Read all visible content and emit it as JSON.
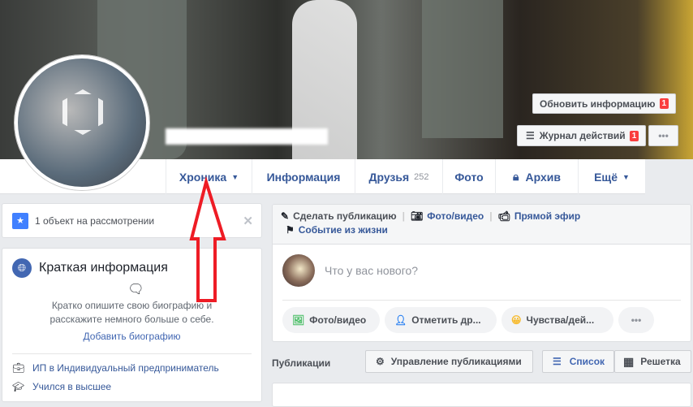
{
  "cover": {
    "update_info": "Обновить информацию",
    "update_badge": "1",
    "activity_log": "Журнал действий",
    "activity_badge": "1",
    "more": "•••"
  },
  "nav": {
    "tabs": [
      {
        "label": "Хроника"
      },
      {
        "label": "Информация"
      },
      {
        "label": "Друзья",
        "count": "252"
      },
      {
        "label": "Фото"
      },
      {
        "label": "Архив"
      },
      {
        "label": "Ещё"
      }
    ]
  },
  "review": {
    "text": "1 объект на рассмотрении"
  },
  "intro": {
    "title": "Краткая информация",
    "desc": "Кратко опишите свою биографию и расскажите немного больше о себе.",
    "add_bio": "Добавить биографию",
    "items": [
      "ИП в Индивидуальный предприниматель",
      "Учился в высшее"
    ]
  },
  "composer": {
    "actions": [
      "Сделать публикацию",
      "Фото/видео",
      "Прямой эфир",
      "Событие из жизни"
    ],
    "placeholder": "Что у вас нового?",
    "buttons": [
      "Фото/видео",
      "Отметить др...",
      "Чувства/дей...",
      "•••"
    ]
  },
  "posts": {
    "title": "Публикации",
    "manage": "Управление публикациями",
    "list": "Список",
    "grid": "Решетка"
  },
  "colors": {
    "link": "#365899",
    "arrow": "#ee1c25",
    "badge": "#fa3e3e"
  }
}
